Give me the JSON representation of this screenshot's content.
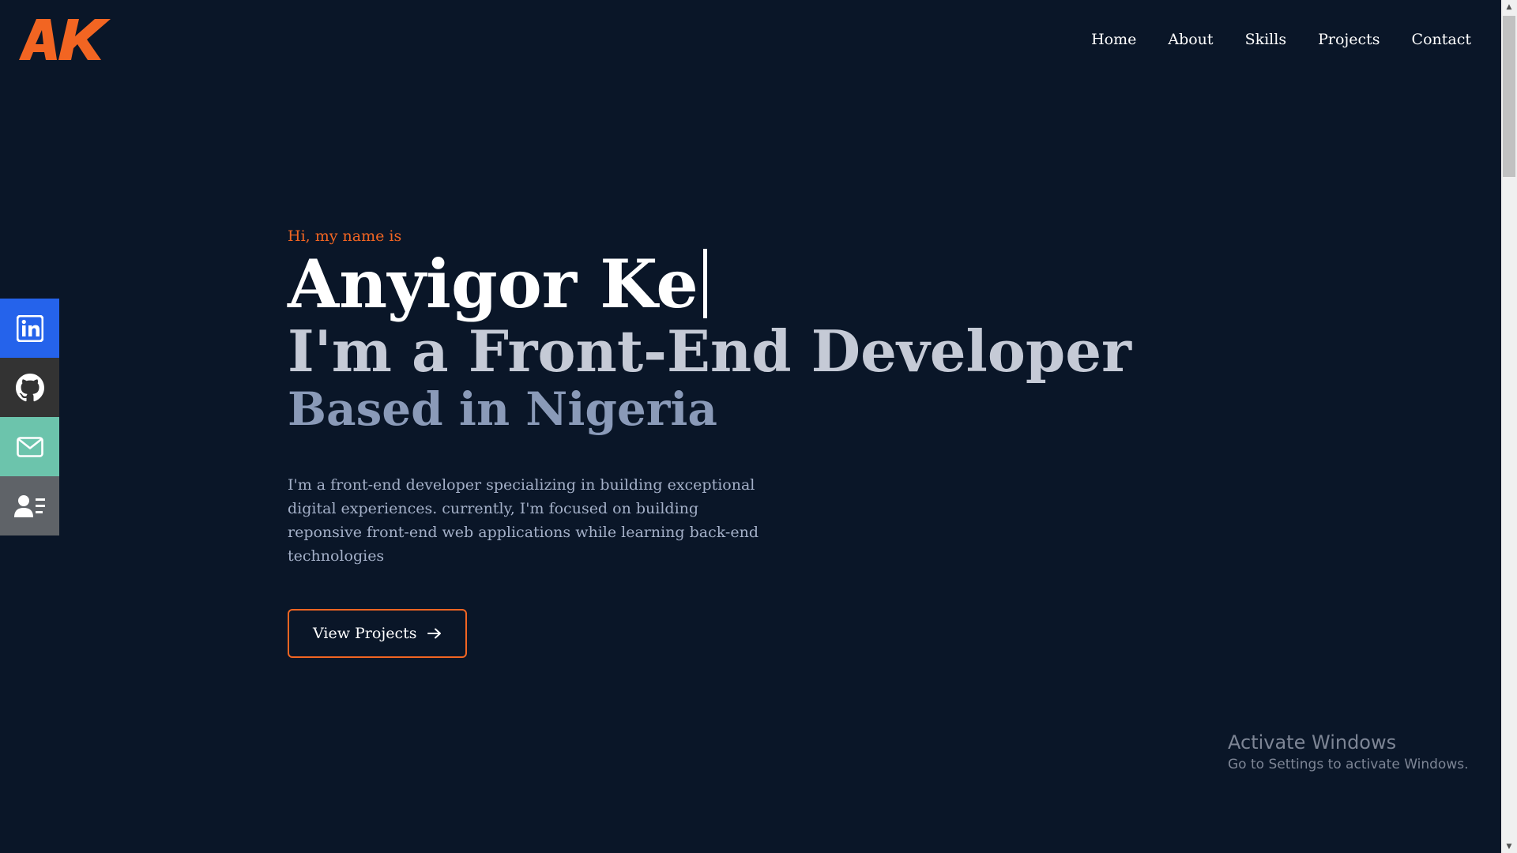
{
  "logo": {
    "text": "AK",
    "color": "#f26522"
  },
  "nav": {
    "items": [
      {
        "label": "Home"
      },
      {
        "label": "About"
      },
      {
        "label": "Skills"
      },
      {
        "label": "Projects"
      },
      {
        "label": "Contact"
      }
    ]
  },
  "social": {
    "items": [
      {
        "icon": "linkedin-icon",
        "color": "#2563eb"
      },
      {
        "icon": "github-icon",
        "color": "#333333"
      },
      {
        "icon": "mail-icon",
        "color": "#6cc4ac"
      },
      {
        "icon": "contact-card-icon",
        "color": "#5f6368"
      }
    ]
  },
  "hero": {
    "greeting": "Hi, my name is",
    "name": "Anyigor Ke",
    "role": "I'm a Front-End Developer",
    "location": "Based in Nigeria",
    "description": "I'm a front-end developer specializing in building exceptional digital experiences. currently, I'm focused on building reponsive front-end web applications while learning back-end technologies",
    "cta_label": "View Projects",
    "cta_icon": "arrow-right-icon",
    "accent": "#f26522"
  },
  "watermark": {
    "title": "Activate Windows",
    "subtitle": "Go to Settings to activate Windows."
  },
  "colors": {
    "background": "#0a1628",
    "text_primary": "#ffffff"
  }
}
